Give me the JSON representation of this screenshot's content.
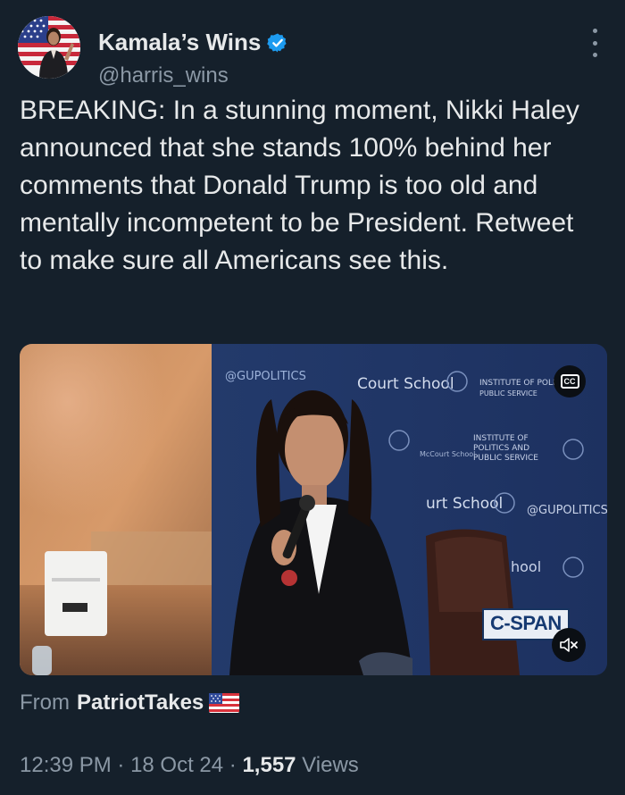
{
  "author": {
    "display_name": "Kamala’s Wins",
    "handle": "@harris_wins",
    "verified": true,
    "avatar_icon": "avatar-photo"
  },
  "tweet": {
    "text": "BREAKING: In a stunning moment, Nikki Haley announced that she stands 100% behind her comments that Donald Trump is too old and mentally incompetent to be President. Retweet to make sure all Americans see this."
  },
  "media": {
    "type": "video",
    "backdrop_texts": [
      "@GUPOLITICS",
      "Court School",
      "INSTITUTE OF POLITICS AND PUBLIC SERVICE",
      "McCourt School",
      "@GUPOLITICS"
    ],
    "cc_label": "CC",
    "broadcaster_logo": "C-SPAN",
    "mute_icon": "speaker-muted-icon"
  },
  "source": {
    "prefix": "From",
    "name": "PatriotTakes",
    "flag_icon": "us-flag-icon"
  },
  "meta": {
    "time": "12:39 PM",
    "separator": " · ",
    "date": "18 Oct 24",
    "views_count": "1,557",
    "views_label": " Views"
  },
  "colors": {
    "background": "#15202b",
    "text_primary": "#e7e9ea",
    "text_secondary": "#8b98a5",
    "verified_blue": "#1d9bf0"
  }
}
